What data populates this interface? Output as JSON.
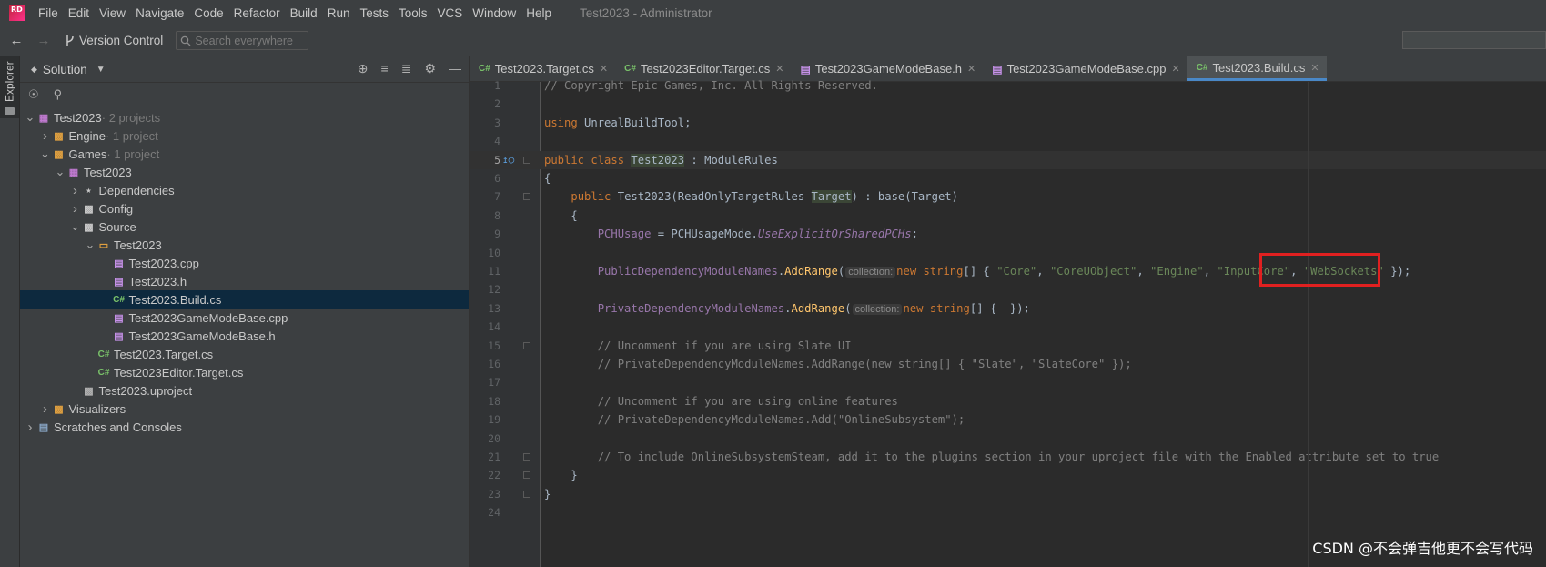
{
  "app": {
    "logo_text": "RD",
    "window_title": "Test2023 - Administrator",
    "menu": [
      "File",
      "Edit",
      "View",
      "Navigate",
      "Code",
      "Refactor",
      "Build",
      "Run",
      "Tests",
      "Tools",
      "VCS",
      "Window",
      "Help"
    ]
  },
  "toolbar": {
    "back_icon": "arrow-left-icon",
    "forward_icon": "arrow-right-icon",
    "version_control": "Version Control",
    "search_placeholder": "Search everywhere"
  },
  "side_strip": {
    "label": "Explorer"
  },
  "explorer": {
    "title": "Solution",
    "tree": [
      {
        "depth": 0,
        "arrow": "down",
        "icon": "solution",
        "label": "Test2023",
        "meta": " · 2 projects"
      },
      {
        "depth": 1,
        "arrow": "right",
        "icon": "folder-unreal",
        "label": "Engine",
        "meta": " · 1 project"
      },
      {
        "depth": 1,
        "arrow": "down",
        "icon": "folder-unreal",
        "label": "Games",
        "meta": " · 1 project"
      },
      {
        "depth": 2,
        "arrow": "down",
        "icon": "project",
        "label": "Test2023",
        "meta": ""
      },
      {
        "depth": 3,
        "arrow": "right",
        "icon": "dependencies",
        "label": "Dependencies",
        "meta": ""
      },
      {
        "depth": 3,
        "arrow": "right",
        "icon": "folder",
        "label": "Config",
        "meta": ""
      },
      {
        "depth": 3,
        "arrow": "down",
        "icon": "folder",
        "label": "Source",
        "meta": ""
      },
      {
        "depth": 4,
        "arrow": "down",
        "icon": "folder-orange",
        "label": "Test2023",
        "meta": ""
      },
      {
        "depth": 5,
        "arrow": "none",
        "icon": "cpp",
        "label": "Test2023.cpp",
        "meta": ""
      },
      {
        "depth": 5,
        "arrow": "none",
        "icon": "h",
        "label": "Test2023.h",
        "meta": ""
      },
      {
        "depth": 5,
        "arrow": "none",
        "icon": "cs",
        "label": "Test2023.Build.cs",
        "meta": "",
        "selected": true
      },
      {
        "depth": 5,
        "arrow": "none",
        "icon": "cpp",
        "label": "Test2023GameModeBase.cpp",
        "meta": ""
      },
      {
        "depth": 5,
        "arrow": "none",
        "icon": "h",
        "label": "Test2023GameModeBase.h",
        "meta": ""
      },
      {
        "depth": 4,
        "arrow": "none",
        "icon": "cs",
        "label": "Test2023.Target.cs",
        "meta": ""
      },
      {
        "depth": 4,
        "arrow": "none",
        "icon": "cs",
        "label": "Test2023Editor.Target.cs",
        "meta": ""
      },
      {
        "depth": 3,
        "arrow": "none",
        "icon": "uproject",
        "label": "Test2023.uproject",
        "meta": ""
      },
      {
        "depth": 1,
        "arrow": "right",
        "icon": "folder-unreal",
        "label": "Visualizers",
        "meta": ""
      },
      {
        "depth": 0,
        "arrow": "right",
        "icon": "scratches",
        "label": "Scratches and Consoles",
        "meta": ""
      }
    ]
  },
  "tabs": [
    {
      "icon": "C#",
      "label": "Test2023.Target.cs",
      "active": false
    },
    {
      "icon": "C#",
      "label": "Test2023Editor.Target.cs",
      "active": false
    },
    {
      "icon": "h",
      "label": "Test2023GameModeBase.h",
      "active": false
    },
    {
      "icon": "cpp",
      "label": "Test2023GameModeBase.cpp",
      "active": false
    },
    {
      "icon": "C#",
      "label": "Test2023.Build.cs",
      "active": true
    }
  ],
  "editor": {
    "current_line": 5,
    "hint_label": "collection:",
    "lines": [
      {
        "n": 1,
        "parts": [
          [
            "cmt",
            "// Copyright Epic Games, Inc. All Rights Reserved."
          ]
        ]
      },
      {
        "n": 2,
        "parts": []
      },
      {
        "n": 3,
        "parts": [
          [
            "kw",
            "using "
          ],
          [
            "",
            "UnrealBuildTool;"
          ]
        ]
      },
      {
        "n": 4,
        "parts": []
      },
      {
        "n": 5,
        "parts": [
          [
            "kw",
            "public class "
          ],
          [
            "hl",
            "Test2023"
          ],
          [
            "",
            " : ModuleRules"
          ]
        ]
      },
      {
        "n": 6,
        "parts": [
          [
            "",
            "{"
          ]
        ]
      },
      {
        "n": 7,
        "parts": [
          [
            "",
            "    "
          ],
          [
            "kw",
            "public "
          ],
          [
            "",
            "Test2023(ReadOnlyTargetRules "
          ],
          [
            "hl",
            "Target"
          ],
          [
            "",
            ") : base(Target)"
          ]
        ]
      },
      {
        "n": 8,
        "parts": [
          [
            "",
            "    {"
          ]
        ]
      },
      {
        "n": 9,
        "parts": [
          [
            "",
            "        "
          ],
          [
            "fld",
            "PCHUsage"
          ],
          [
            "",
            " = PCHUsageMode."
          ],
          [
            "ital",
            "UseExplicitOrSharedPCHs"
          ],
          [
            "",
            ";"
          ]
        ]
      },
      {
        "n": 10,
        "parts": []
      },
      {
        "n": 11,
        "parts": [
          [
            "",
            "        "
          ],
          [
            "fld",
            "PublicDependencyModuleNames"
          ],
          [
            "",
            "."
          ],
          [
            "fn",
            "AddRange"
          ],
          [
            "",
            "("
          ],
          [
            "hint",
            "collection:"
          ],
          [
            "kw",
            "new "
          ],
          [
            "kw",
            "string"
          ],
          [
            "",
            "[] { "
          ],
          [
            "str",
            "\"Core\""
          ],
          [
            "",
            ", "
          ],
          [
            "str",
            "\"CoreUObject\""
          ],
          [
            "",
            ", "
          ],
          [
            "str",
            "\"Engine\""
          ],
          [
            "",
            ", "
          ],
          [
            "str",
            "\"InputCore\""
          ],
          [
            "",
            ", "
          ],
          [
            "str",
            "\"WebSockets\""
          ],
          [
            "",
            " });"
          ]
        ]
      },
      {
        "n": 12,
        "parts": []
      },
      {
        "n": 13,
        "parts": [
          [
            "",
            "        "
          ],
          [
            "fld",
            "PrivateDependencyModuleNames"
          ],
          [
            "",
            "."
          ],
          [
            "fn",
            "AddRange"
          ],
          [
            "",
            "("
          ],
          [
            "hint",
            "collection:"
          ],
          [
            "kw",
            "new "
          ],
          [
            "kw",
            "string"
          ],
          [
            "",
            "[] {  });"
          ]
        ]
      },
      {
        "n": 14,
        "parts": []
      },
      {
        "n": 15,
        "parts": [
          [
            "",
            "        "
          ],
          [
            "cmt",
            "// Uncomment if you are using Slate UI"
          ]
        ]
      },
      {
        "n": 16,
        "parts": [
          [
            "",
            "        "
          ],
          [
            "cmt",
            "// PrivateDependencyModuleNames.AddRange(new string[] { \"Slate\", \"SlateCore\" });"
          ]
        ]
      },
      {
        "n": 17,
        "parts": []
      },
      {
        "n": 18,
        "parts": [
          [
            "",
            "        "
          ],
          [
            "cmt",
            "// Uncomment if you are using online features"
          ]
        ]
      },
      {
        "n": 19,
        "parts": [
          [
            "",
            "        "
          ],
          [
            "cmt",
            "// PrivateDependencyModuleNames.Add(\"OnlineSubsystem\");"
          ]
        ]
      },
      {
        "n": 20,
        "parts": []
      },
      {
        "n": 21,
        "parts": [
          [
            "",
            "        "
          ],
          [
            "cmt",
            "// To include OnlineSubsystemSteam, add it to the plugins section in your uproject file with the Enabled attribute set to true"
          ]
        ]
      },
      {
        "n": 22,
        "parts": [
          [
            "",
            "    }"
          ]
        ]
      },
      {
        "n": 23,
        "parts": [
          [
            "",
            "}"
          ]
        ]
      },
      {
        "n": 24,
        "parts": []
      }
    ]
  },
  "watermark": "CSDN @不会弹吉他更不会写代码",
  "colors": {
    "highlight_box": "#e02020",
    "selection": "#0d293e",
    "active_tab_underline": "#4a88c7"
  }
}
